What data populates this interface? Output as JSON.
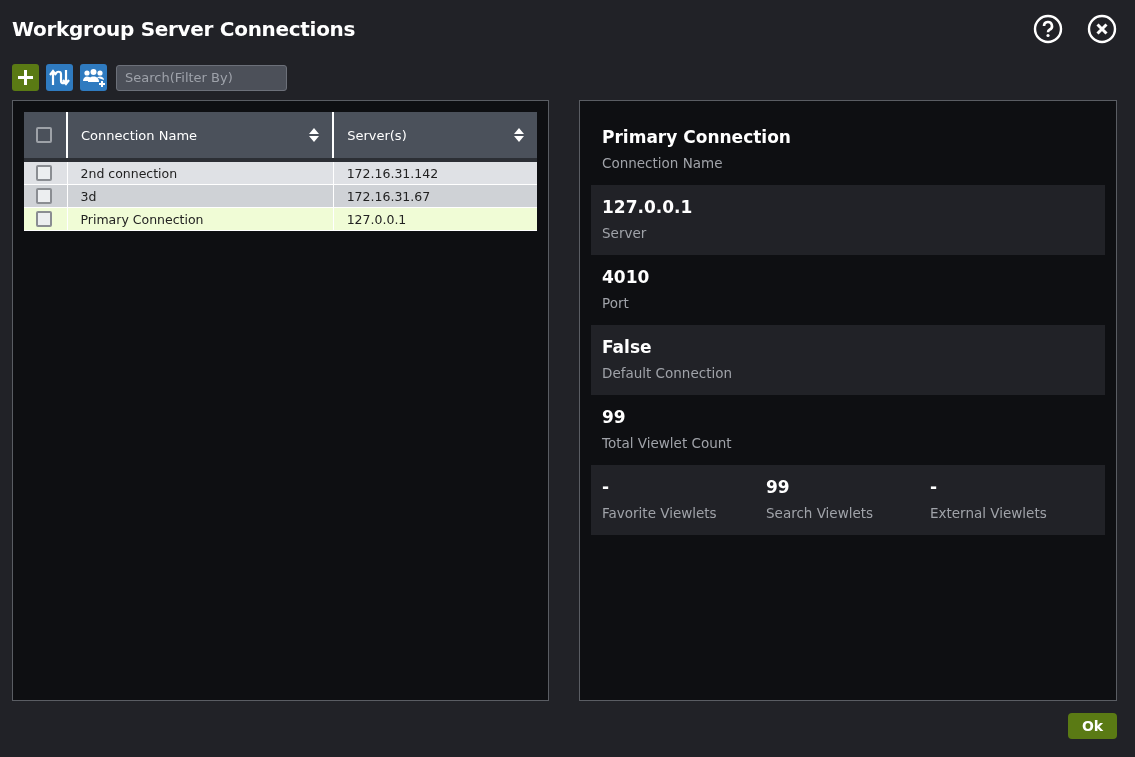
{
  "window": {
    "title": "Workgroup Server Connections"
  },
  "toolbar": {
    "search": {
      "placeholder": "Search(Filter By)"
    }
  },
  "table": {
    "header_checkbox": {
      "checked": false
    },
    "columns": [
      "Connection Name",
      "Server(s)"
    ],
    "rows": [
      {
        "cells": [
          "2nd connection",
          "172.16.31.142"
        ],
        "checked": false,
        "selected": false
      },
      {
        "cells": [
          "3d",
          "172.16.31.67"
        ],
        "checked": false,
        "selected": false
      },
      {
        "cells": [
          "Primary Connection",
          "127.0.0.1"
        ],
        "checked": false,
        "selected": true
      }
    ]
  },
  "details": [
    {
      "fields": [
        {
          "value": "Primary Connection",
          "label": "Connection Name"
        }
      ]
    },
    {
      "fields": [
        {
          "value": "127.0.0.1",
          "label": "Server"
        }
      ]
    },
    {
      "fields": [
        {
          "value": "4010",
          "label": "Port"
        }
      ]
    },
    {
      "fields": [
        {
          "value": "False",
          "label": "Default Connection"
        }
      ]
    },
    {
      "fields": [
        {
          "value": "99",
          "label": "Total Viewlet Count"
        }
      ]
    },
    {
      "fields": [
        {
          "value": "-",
          "label": "Favorite Viewlets"
        },
        {
          "value": "99",
          "label": "Search Viewlets"
        },
        {
          "value": "-",
          "label": "External Viewlets"
        }
      ]
    }
  ],
  "buttons": [
    "Ok"
  ]
}
